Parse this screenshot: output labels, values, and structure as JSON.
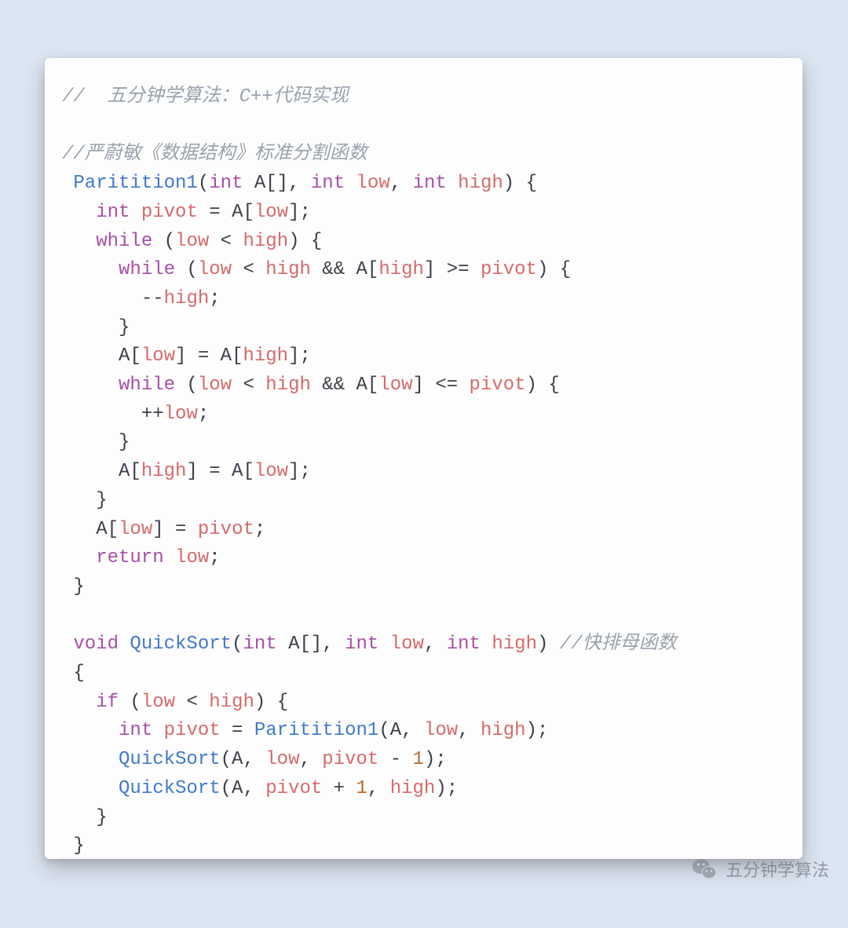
{
  "code": {
    "comment_top": "//  五分钟学算法：C++代码实现",
    "comment_partition": "//严蔚敏《数据结构》标准分割函数",
    "comment_quicksort": "//快排母函数",
    "fn_partition": "Paritition1",
    "fn_quicksort": "QuickSort",
    "kw_int": "int",
    "kw_void": "void",
    "kw_while": "while",
    "kw_if": "if",
    "kw_return": "return",
    "id_A": "A",
    "id_low": "low",
    "id_high": "high",
    "id_pivot": "pivot",
    "num_1": "1"
  },
  "watermark": {
    "text": "五分钟学算法"
  }
}
